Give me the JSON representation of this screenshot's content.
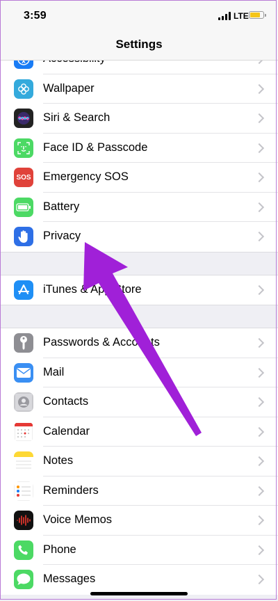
{
  "status": {
    "time": "3:59",
    "network": "LTE"
  },
  "nav": {
    "title": "Settings"
  },
  "groups": [
    {
      "items": [
        {
          "label": "Accessibility",
          "icon": "accessibility-icon",
          "color": "#1a7cf5"
        },
        {
          "label": "Wallpaper",
          "icon": "wallpaper-icon",
          "color": "#34aadc"
        },
        {
          "label": "Siri & Search",
          "icon": "siri-icon",
          "color": "#222222"
        },
        {
          "label": "Face ID & Passcode",
          "icon": "face-id-icon",
          "color": "#4cd964"
        },
        {
          "label": "Emergency SOS",
          "icon": "sos-icon",
          "color": "#e0423a",
          "glyph": "SOS"
        },
        {
          "label": "Battery",
          "icon": "battery-icon",
          "color": "#4cd964"
        },
        {
          "label": "Privacy",
          "icon": "hand-icon",
          "color": "#2e6fe6"
        }
      ]
    },
    {
      "items": [
        {
          "label": "iTunes & App Store",
          "icon": "app-store-icon",
          "color": "#1f8ff5"
        }
      ]
    },
    {
      "items": [
        {
          "label": "Passwords & Accounts",
          "icon": "key-icon",
          "color": "#8e8e93"
        },
        {
          "label": "Mail",
          "icon": "mail-icon",
          "color": "#3a8ff3"
        },
        {
          "label": "Contacts",
          "icon": "contacts-icon",
          "color": "#c8c8cc"
        },
        {
          "label": "Calendar",
          "icon": "calendar-icon",
          "color": "#ffffff"
        },
        {
          "label": "Notes",
          "icon": "notes-icon",
          "color": "#ffffff"
        },
        {
          "label": "Reminders",
          "icon": "reminders-icon",
          "color": "#ffffff"
        },
        {
          "label": "Voice Memos",
          "icon": "voice-memos-icon",
          "color": "#111111"
        },
        {
          "label": "Phone",
          "icon": "phone-icon",
          "color": "#4cd964"
        },
        {
          "label": "Messages",
          "icon": "messages-icon",
          "color": "#4cd964"
        }
      ]
    }
  ],
  "annotation": {
    "color": "#a020d8"
  }
}
